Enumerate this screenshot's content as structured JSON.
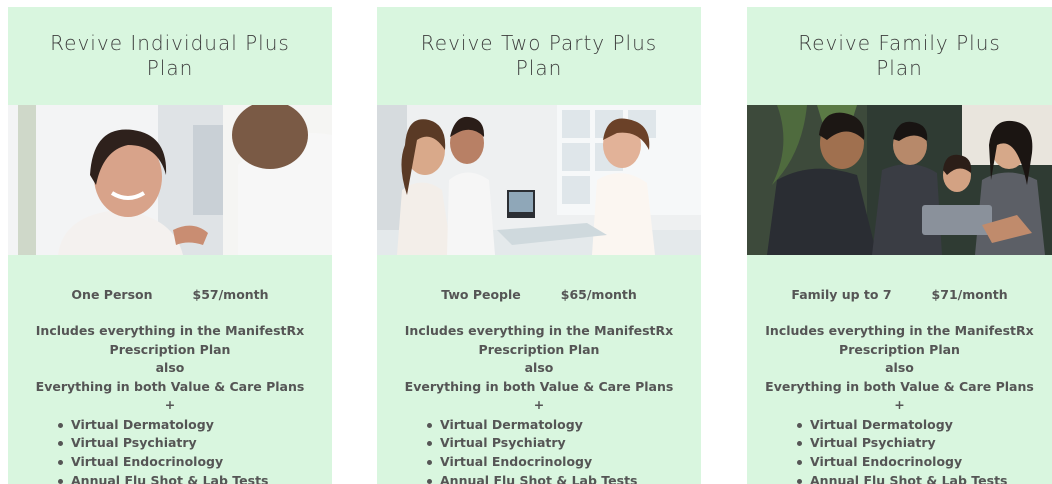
{
  "plans": [
    {
      "title": "Revive Individual Plus Plan",
      "photo_icon": "doctor-patient-photo",
      "people": "One Person",
      "price": "$57/month",
      "includes_line1": "Includes everything in the ManifestRx",
      "includes_line2": "Prescription Plan",
      "also": "also",
      "everything": "Everything in both Value & Care Plans",
      "plus": "+",
      "features": [
        "Virtual Dermatology",
        "Virtual Psychiatry",
        "Virtual Endocrinology",
        "Annual Flu Shot & Lab Tests"
      ]
    },
    {
      "title": "Revive Two Party Plus Plan",
      "photo_icon": "couple-consultation-photo",
      "people": "Two People",
      "price": "$65/month",
      "includes_line1": "Includes everything in the ManifestRx",
      "includes_line2": "Prescription Plan",
      "also": "also",
      "everything": "Everything in both Value & Care Plans",
      "plus": "+",
      "features": [
        "Virtual Dermatology",
        "Virtual Psychiatry",
        "Virtual Endocrinology",
        "Annual Flu Shot & Lab Tests"
      ]
    },
    {
      "title": "Revive Family Plus Plan",
      "photo_icon": "family-consultation-photo",
      "people": "Family up to 7",
      "price": "$71/month",
      "includes_line1": "Includes everything in the ManifestRx",
      "includes_line2": "Prescription Plan",
      "also": "also",
      "everything": "Everything in both Value & Care Plans",
      "plus": "+",
      "features": [
        "Virtual Dermatology",
        "Virtual Psychiatry",
        "Virtual Endocrinology",
        "Annual Flu Shot & Lab Tests"
      ]
    }
  ],
  "colors": {
    "card_bg": "#d9f6df",
    "text": "#555555",
    "title": "#3d3d3d"
  }
}
